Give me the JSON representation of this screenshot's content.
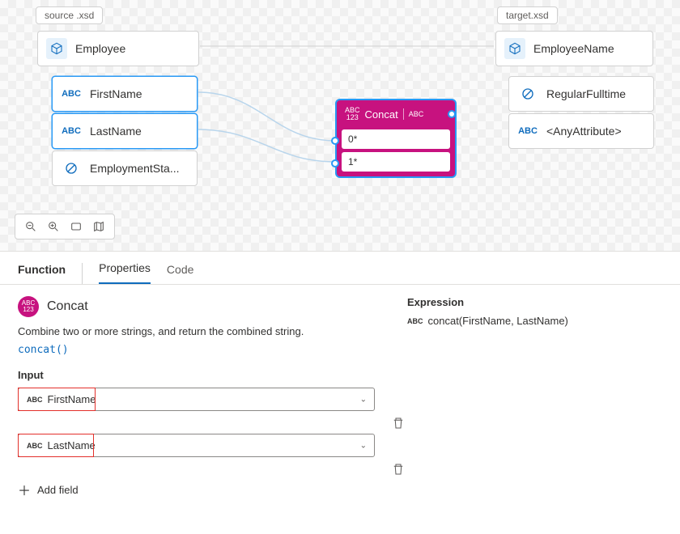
{
  "source": {
    "label": "source .xsd",
    "root": "Employee",
    "children": [
      "FirstName",
      "LastName",
      "EmploymentSta..."
    ]
  },
  "target": {
    "label": "target.xsd",
    "root": "EmployeeName",
    "children": [
      "RegularFulltime",
      "<AnyAttribute>"
    ]
  },
  "func": {
    "name": "Concat",
    "slots": [
      "0*",
      "1*"
    ],
    "in_type": "ABC\n123",
    "out_type": "ABC"
  },
  "panel": {
    "tab_function": "Function",
    "tab_properties": "Properties",
    "tab_code": "Code",
    "title": "Concat",
    "description": "Combine two or more strings, and return the combined string.",
    "code": "concat()",
    "input_label": "Input",
    "inputs": [
      "FirstName",
      "LastName"
    ],
    "add_field": "Add field",
    "expression_label": "Expression",
    "expression": "concat(FirstName, LastName)"
  }
}
